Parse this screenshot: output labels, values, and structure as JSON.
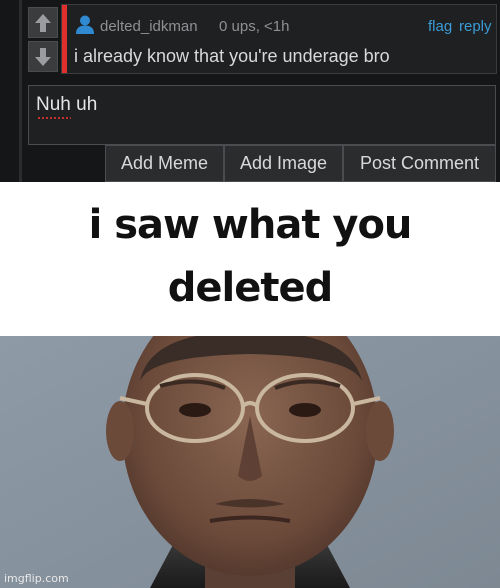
{
  "comment": {
    "username": "delted_idkman",
    "meta": "0 ups, <1h",
    "flag_label": "flag",
    "reply_label": "reply",
    "text": "i already know that you're underage bro",
    "accent_color": "#e0302e"
  },
  "reply_box": {
    "value": "Nuh uh"
  },
  "buttons": {
    "add_meme": "Add Meme",
    "add_image": "Add Image",
    "post_comment": "Post Comment"
  },
  "meme": {
    "line1": "i saw what you",
    "line2": "deleted",
    "watermark": "imgflip.com"
  },
  "icons": {
    "user": "user-icon",
    "upvote": "arrow-up-icon",
    "downvote": "arrow-down-icon"
  }
}
